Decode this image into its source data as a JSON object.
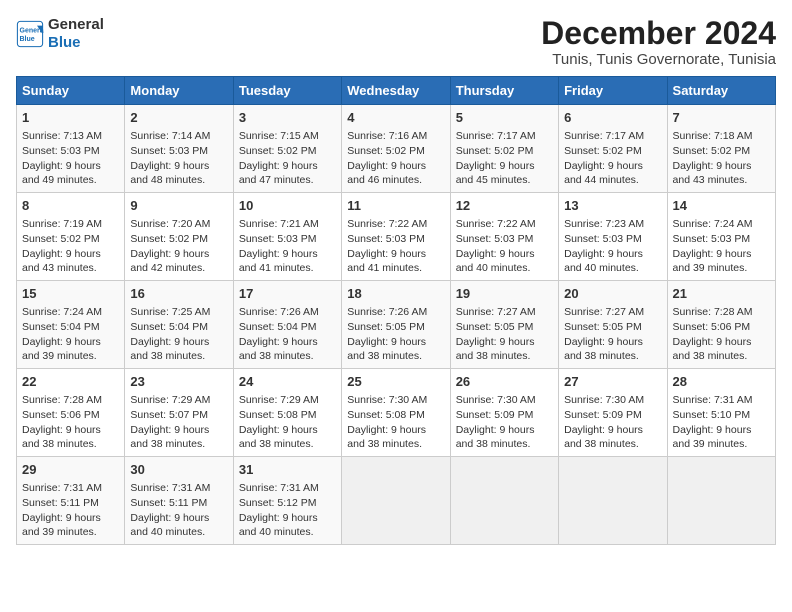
{
  "logo": {
    "line1": "General",
    "line2": "Blue"
  },
  "title": "December 2024",
  "subtitle": "Tunis, Tunis Governorate, Tunisia",
  "weekdays": [
    "Sunday",
    "Monday",
    "Tuesday",
    "Wednesday",
    "Thursday",
    "Friday",
    "Saturday"
  ],
  "weeks": [
    [
      {
        "day": "1",
        "info": "Sunrise: 7:13 AM\nSunset: 5:03 PM\nDaylight: 9 hours\nand 49 minutes."
      },
      {
        "day": "2",
        "info": "Sunrise: 7:14 AM\nSunset: 5:03 PM\nDaylight: 9 hours\nand 48 minutes."
      },
      {
        "day": "3",
        "info": "Sunrise: 7:15 AM\nSunset: 5:02 PM\nDaylight: 9 hours\nand 47 minutes."
      },
      {
        "day": "4",
        "info": "Sunrise: 7:16 AM\nSunset: 5:02 PM\nDaylight: 9 hours\nand 46 minutes."
      },
      {
        "day": "5",
        "info": "Sunrise: 7:17 AM\nSunset: 5:02 PM\nDaylight: 9 hours\nand 45 minutes."
      },
      {
        "day": "6",
        "info": "Sunrise: 7:17 AM\nSunset: 5:02 PM\nDaylight: 9 hours\nand 44 minutes."
      },
      {
        "day": "7",
        "info": "Sunrise: 7:18 AM\nSunset: 5:02 PM\nDaylight: 9 hours\nand 43 minutes."
      }
    ],
    [
      {
        "day": "8",
        "info": "Sunrise: 7:19 AM\nSunset: 5:02 PM\nDaylight: 9 hours\nand 43 minutes."
      },
      {
        "day": "9",
        "info": "Sunrise: 7:20 AM\nSunset: 5:02 PM\nDaylight: 9 hours\nand 42 minutes."
      },
      {
        "day": "10",
        "info": "Sunrise: 7:21 AM\nSunset: 5:03 PM\nDaylight: 9 hours\nand 41 minutes."
      },
      {
        "day": "11",
        "info": "Sunrise: 7:22 AM\nSunset: 5:03 PM\nDaylight: 9 hours\nand 41 minutes."
      },
      {
        "day": "12",
        "info": "Sunrise: 7:22 AM\nSunset: 5:03 PM\nDaylight: 9 hours\nand 40 minutes."
      },
      {
        "day": "13",
        "info": "Sunrise: 7:23 AM\nSunset: 5:03 PM\nDaylight: 9 hours\nand 40 minutes."
      },
      {
        "day": "14",
        "info": "Sunrise: 7:24 AM\nSunset: 5:03 PM\nDaylight: 9 hours\nand 39 minutes."
      }
    ],
    [
      {
        "day": "15",
        "info": "Sunrise: 7:24 AM\nSunset: 5:04 PM\nDaylight: 9 hours\nand 39 minutes."
      },
      {
        "day": "16",
        "info": "Sunrise: 7:25 AM\nSunset: 5:04 PM\nDaylight: 9 hours\nand 38 minutes."
      },
      {
        "day": "17",
        "info": "Sunrise: 7:26 AM\nSunset: 5:04 PM\nDaylight: 9 hours\nand 38 minutes."
      },
      {
        "day": "18",
        "info": "Sunrise: 7:26 AM\nSunset: 5:05 PM\nDaylight: 9 hours\nand 38 minutes."
      },
      {
        "day": "19",
        "info": "Sunrise: 7:27 AM\nSunset: 5:05 PM\nDaylight: 9 hours\nand 38 minutes."
      },
      {
        "day": "20",
        "info": "Sunrise: 7:27 AM\nSunset: 5:05 PM\nDaylight: 9 hours\nand 38 minutes."
      },
      {
        "day": "21",
        "info": "Sunrise: 7:28 AM\nSunset: 5:06 PM\nDaylight: 9 hours\nand 38 minutes."
      }
    ],
    [
      {
        "day": "22",
        "info": "Sunrise: 7:28 AM\nSunset: 5:06 PM\nDaylight: 9 hours\nand 38 minutes."
      },
      {
        "day": "23",
        "info": "Sunrise: 7:29 AM\nSunset: 5:07 PM\nDaylight: 9 hours\nand 38 minutes."
      },
      {
        "day": "24",
        "info": "Sunrise: 7:29 AM\nSunset: 5:08 PM\nDaylight: 9 hours\nand 38 minutes."
      },
      {
        "day": "25",
        "info": "Sunrise: 7:30 AM\nSunset: 5:08 PM\nDaylight: 9 hours\nand 38 minutes."
      },
      {
        "day": "26",
        "info": "Sunrise: 7:30 AM\nSunset: 5:09 PM\nDaylight: 9 hours\nand 38 minutes."
      },
      {
        "day": "27",
        "info": "Sunrise: 7:30 AM\nSunset: 5:09 PM\nDaylight: 9 hours\nand 38 minutes."
      },
      {
        "day": "28",
        "info": "Sunrise: 7:31 AM\nSunset: 5:10 PM\nDaylight: 9 hours\nand 39 minutes."
      }
    ],
    [
      {
        "day": "29",
        "info": "Sunrise: 7:31 AM\nSunset: 5:11 PM\nDaylight: 9 hours\nand 39 minutes."
      },
      {
        "day": "30",
        "info": "Sunrise: 7:31 AM\nSunset: 5:11 PM\nDaylight: 9 hours\nand 40 minutes."
      },
      {
        "day": "31",
        "info": "Sunrise: 7:31 AM\nSunset: 5:12 PM\nDaylight: 9 hours\nand 40 minutes."
      },
      {
        "day": "",
        "info": ""
      },
      {
        "day": "",
        "info": ""
      },
      {
        "day": "",
        "info": ""
      },
      {
        "day": "",
        "info": ""
      }
    ]
  ]
}
